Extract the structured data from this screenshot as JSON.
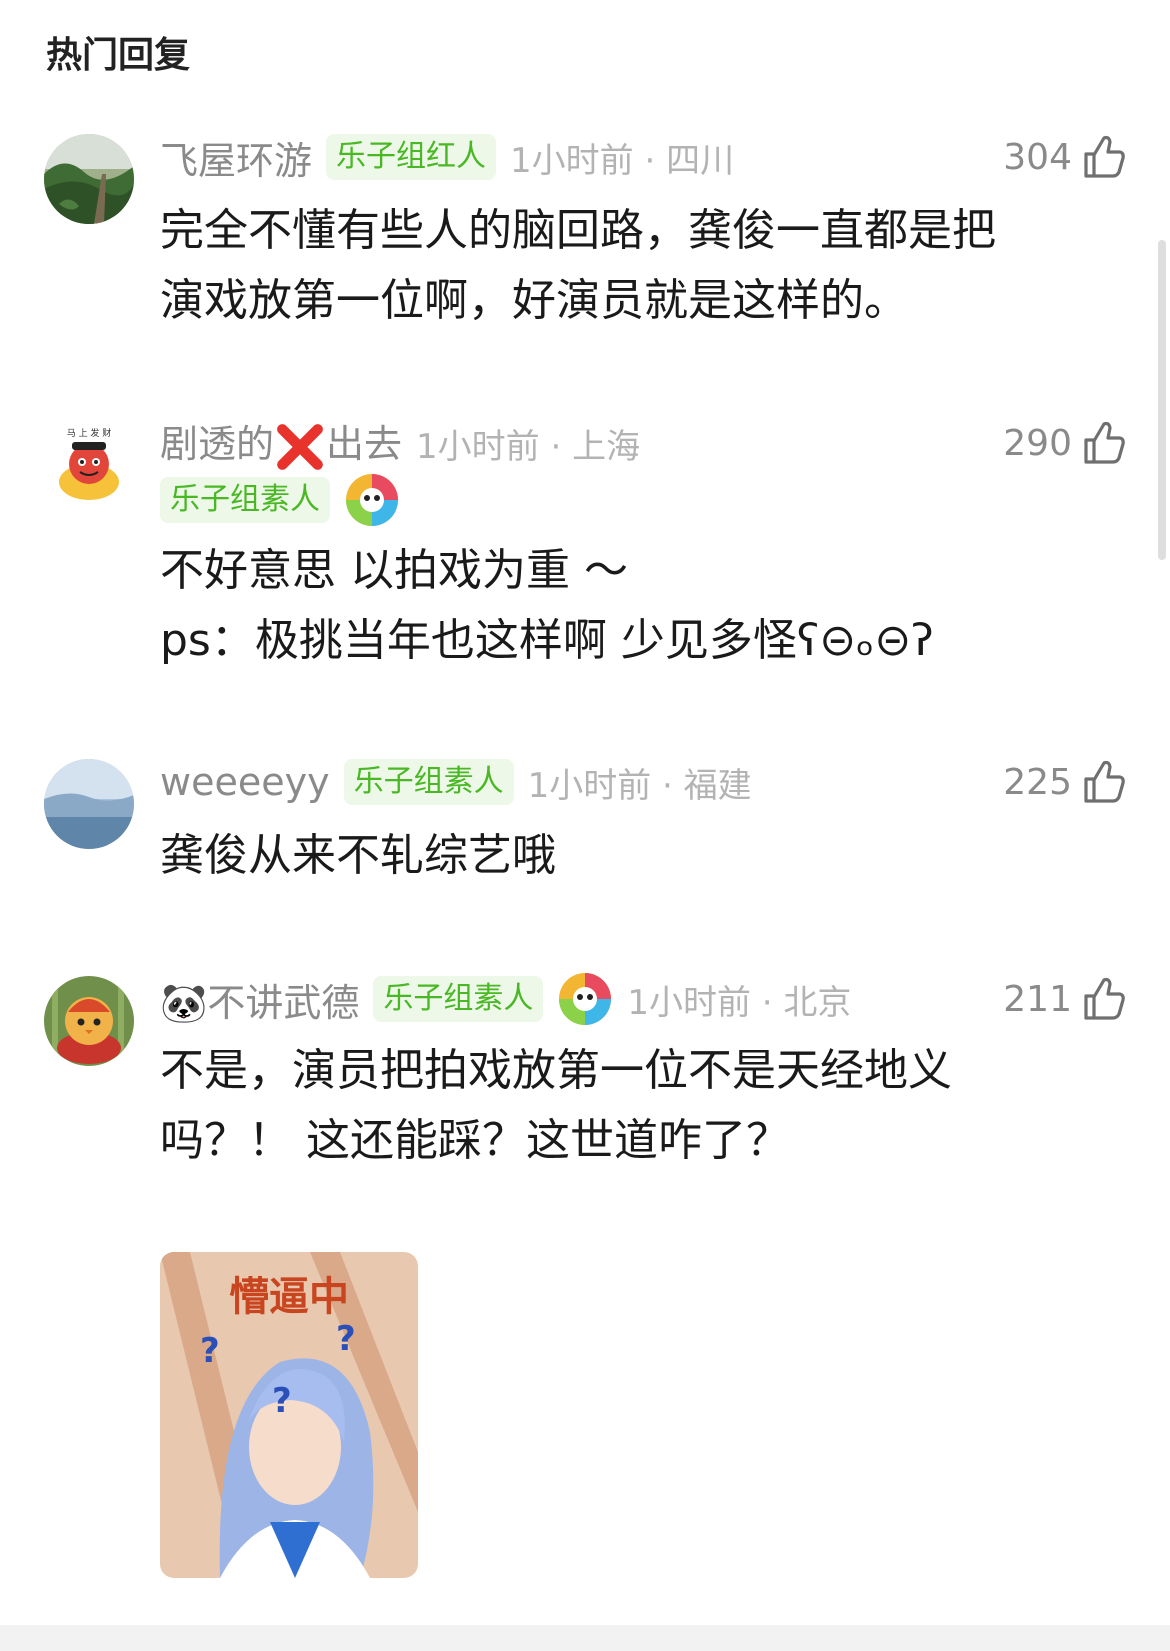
{
  "section": {
    "title": "热门回复"
  },
  "comments": [
    {
      "username": "飞屋环游",
      "badge": "乐子组红人",
      "time": "1小时前 · 四川",
      "likes": "304",
      "text": "完全不懂有些人的脑回路，龚俊一直都是把\n演戏放第一位啊，好演员就是这样的。"
    },
    {
      "username_part1": "剧透的",
      "username_part2": "出去",
      "badge": "乐子组素人",
      "time": "1小时前 · 上海",
      "likes": "290",
      "text": "不好意思 以拍戏为重 ～\nps：极挑当年也这样啊 少见多怪ʕ⊝ₒ⊝ʔ"
    },
    {
      "username": "weeeeyy",
      "badge": "乐子组素人",
      "time": "1小时前 · 福建",
      "likes": "225",
      "text": "龚俊从来不轧综艺哦"
    },
    {
      "username_emoji": "🐼",
      "username": "不讲武德",
      "badge": "乐子组素人",
      "time": "1小时前 · 北京",
      "likes": "211",
      "text": "不是，演员把拍戏放第一位不是天经地义\n吗？！ 这还能踩？这世道咋了？",
      "image_caption": "懵逼中"
    }
  ],
  "colors": {
    "badge_bg": "#edf8e8",
    "badge_text": "#49b824",
    "meta_gray": "#8a8a8a",
    "time_gray": "#b3b3b3",
    "cross_red": "#e8322c"
  }
}
